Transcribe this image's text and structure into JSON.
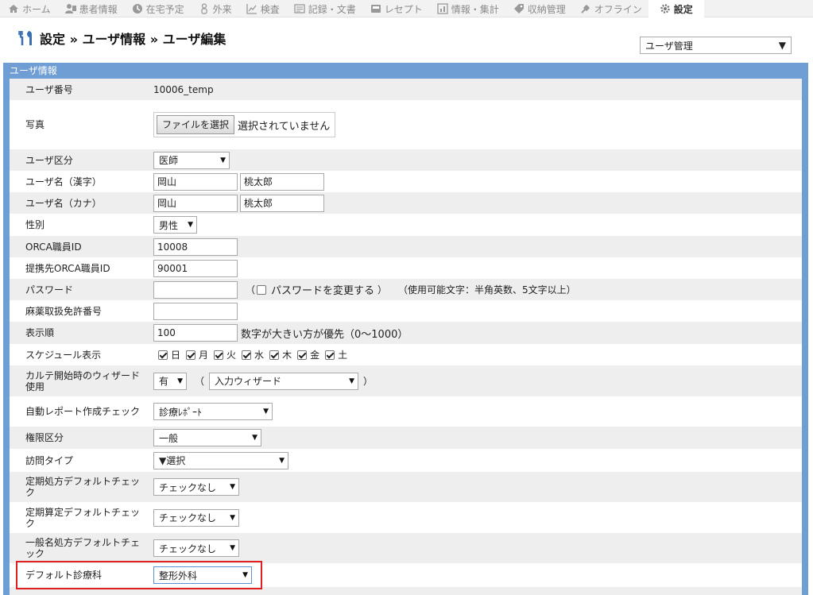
{
  "nav": {
    "tabs": [
      {
        "label": "ホーム",
        "icon": "home-icon"
      },
      {
        "label": "患者情報",
        "icon": "patient-icon"
      },
      {
        "label": "在宅予定",
        "icon": "clock-icon"
      },
      {
        "label": "外来",
        "icon": "person-icon"
      },
      {
        "label": "検査",
        "icon": "chart-icon"
      },
      {
        "label": "記録・文書",
        "icon": "document-icon"
      },
      {
        "label": "レセプト",
        "icon": "receipt-icon"
      },
      {
        "label": "情報・集計",
        "icon": "stats-icon"
      },
      {
        "label": "収納管理",
        "icon": "tag-icon"
      },
      {
        "label": "オフライン",
        "icon": "plug-icon"
      },
      {
        "label": "設定",
        "icon": "gear-icon",
        "active": true
      }
    ]
  },
  "header": {
    "title": "設定 » ユーザ情報 » ユーザ編集",
    "title_icon": "tools-icon",
    "select_value": "ユーザ管理"
  },
  "panel": {
    "title": "ユーザ情報"
  },
  "form": {
    "user_number": {
      "label": "ユーザ番号",
      "value": "10006_temp"
    },
    "photo": {
      "label": "写真",
      "button": "ファイルを選択",
      "status": "選択されていません"
    },
    "user_category": {
      "label": "ユーザ区分",
      "value": "医師"
    },
    "name_kanji": {
      "label": "ユーザ名（漢字）",
      "last": "岡山",
      "first": "桃太郎"
    },
    "name_kana": {
      "label": "ユーザ名（カナ）",
      "last": "岡山",
      "first": "桃太郎"
    },
    "gender": {
      "label": "性別",
      "value": "男性"
    },
    "orca_id": {
      "label": "ORCA職員ID",
      "value": "10008"
    },
    "partner_orca_id": {
      "label": "提携先ORCA職員ID",
      "value": "90001"
    },
    "password": {
      "label": "パスワード",
      "paren_open": "（",
      "change_label": "パスワードを変更する",
      "paren_close": "）",
      "hint": "（使用可能文字：半角英数、5文字以上）"
    },
    "narcotic_license": {
      "label": "麻薬取扱免許番号",
      "value": ""
    },
    "display_order": {
      "label": "表示順",
      "value": "100",
      "hint": "数字が大きい方が優先（0〜1000）"
    },
    "schedule_display": {
      "label": "スケジュール表示",
      "days": [
        "日",
        "月",
        "火",
        "水",
        "木",
        "金",
        "土"
      ]
    },
    "karte_wizard": {
      "label": "カルテ開始時のウィザード使用",
      "value": "有",
      "paren_open": "（",
      "wizard_value": "入力ウィザード",
      "paren_close": "）"
    },
    "auto_report": {
      "label": "自動レポート作成チェック",
      "value": "診療ﾚﾎﾟｰﾄ"
    },
    "authority": {
      "label": "権限区分",
      "value": "一般"
    },
    "visit_type": {
      "label": "訪問タイプ",
      "value": "▼選択"
    },
    "regular_rx_default": {
      "label": "定期処方デフォルトチェック",
      "value": "チェックなし"
    },
    "regular_calc_default": {
      "label": "定期算定デフォルトチェック",
      "value": "チェックなし"
    },
    "generic_rx_default": {
      "label": "一般名処方デフォルトチェック",
      "value": "チェックなし"
    },
    "default_department": {
      "label": "デフォルト診療科",
      "value": "整形外科"
    }
  }
}
